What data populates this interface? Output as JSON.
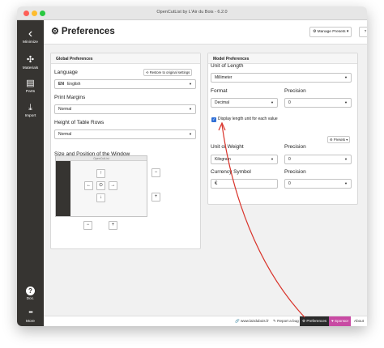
{
  "window": {
    "title": "OpenCutList by L'Air du Bois - 6.2.0"
  },
  "sidebar": {
    "items": [
      {
        "label": "Minimize",
        "icon": "chevron-left-icon",
        "glyph": "‹"
      },
      {
        "label": "Materials",
        "icon": "materials-icon",
        "glyph": "✣"
      },
      {
        "label": "Parts",
        "icon": "parts-icon",
        "glyph": "▤"
      },
      {
        "label": "Import",
        "icon": "import-icon",
        "glyph": "⤓"
      }
    ],
    "bottom": [
      {
        "label": "Doc.",
        "icon": "help-icon",
        "glyph": "?"
      },
      {
        "label": "More",
        "icon": "more-icon",
        "glyph": "•••"
      }
    ]
  },
  "header": {
    "title": "Preferences",
    "manage_presets": "Manage Presets",
    "help": "?"
  },
  "global": {
    "title": "Global Preferences",
    "language_label": "Language",
    "restore_label": "Restore to original settings",
    "language_code": "EN",
    "language_value": "English",
    "print_margins_label": "Print Margins",
    "print_margins_value": "Normal",
    "row_height_label": "Height of Table Rows",
    "row_height_value": "Normal",
    "window_label": "Size and Position of the Window",
    "preview_title": "OpenCutList"
  },
  "model": {
    "title": "Model Preferences",
    "length_unit_label": "Unit of Length",
    "length_unit_value": "Millimeter",
    "format_label": "Format",
    "format_value": "Decimal",
    "precision_label": "Precision",
    "precision_value": "0",
    "display_unit_label": "Display length unit for each value",
    "presets_label": "Presets",
    "weight_unit_label": "Unit of Weight",
    "weight_unit_value": "Kilogram",
    "weight_precision_label": "Precision",
    "weight_precision_value": "0",
    "currency_label": "Currency Symbol",
    "currency_value": "€",
    "currency_precision_label": "Precision",
    "currency_precision_value": "0"
  },
  "footer": {
    "website": "www.lairdubois.fr",
    "report": "Report a bug",
    "preferences": "Preferences",
    "sponsor": "Sponsor",
    "about": "About"
  },
  "colors": {
    "sidebar": "#363431",
    "accent": "#2f6fd6",
    "sponsor": "#c84aa3",
    "annotation": "#d9342b"
  }
}
